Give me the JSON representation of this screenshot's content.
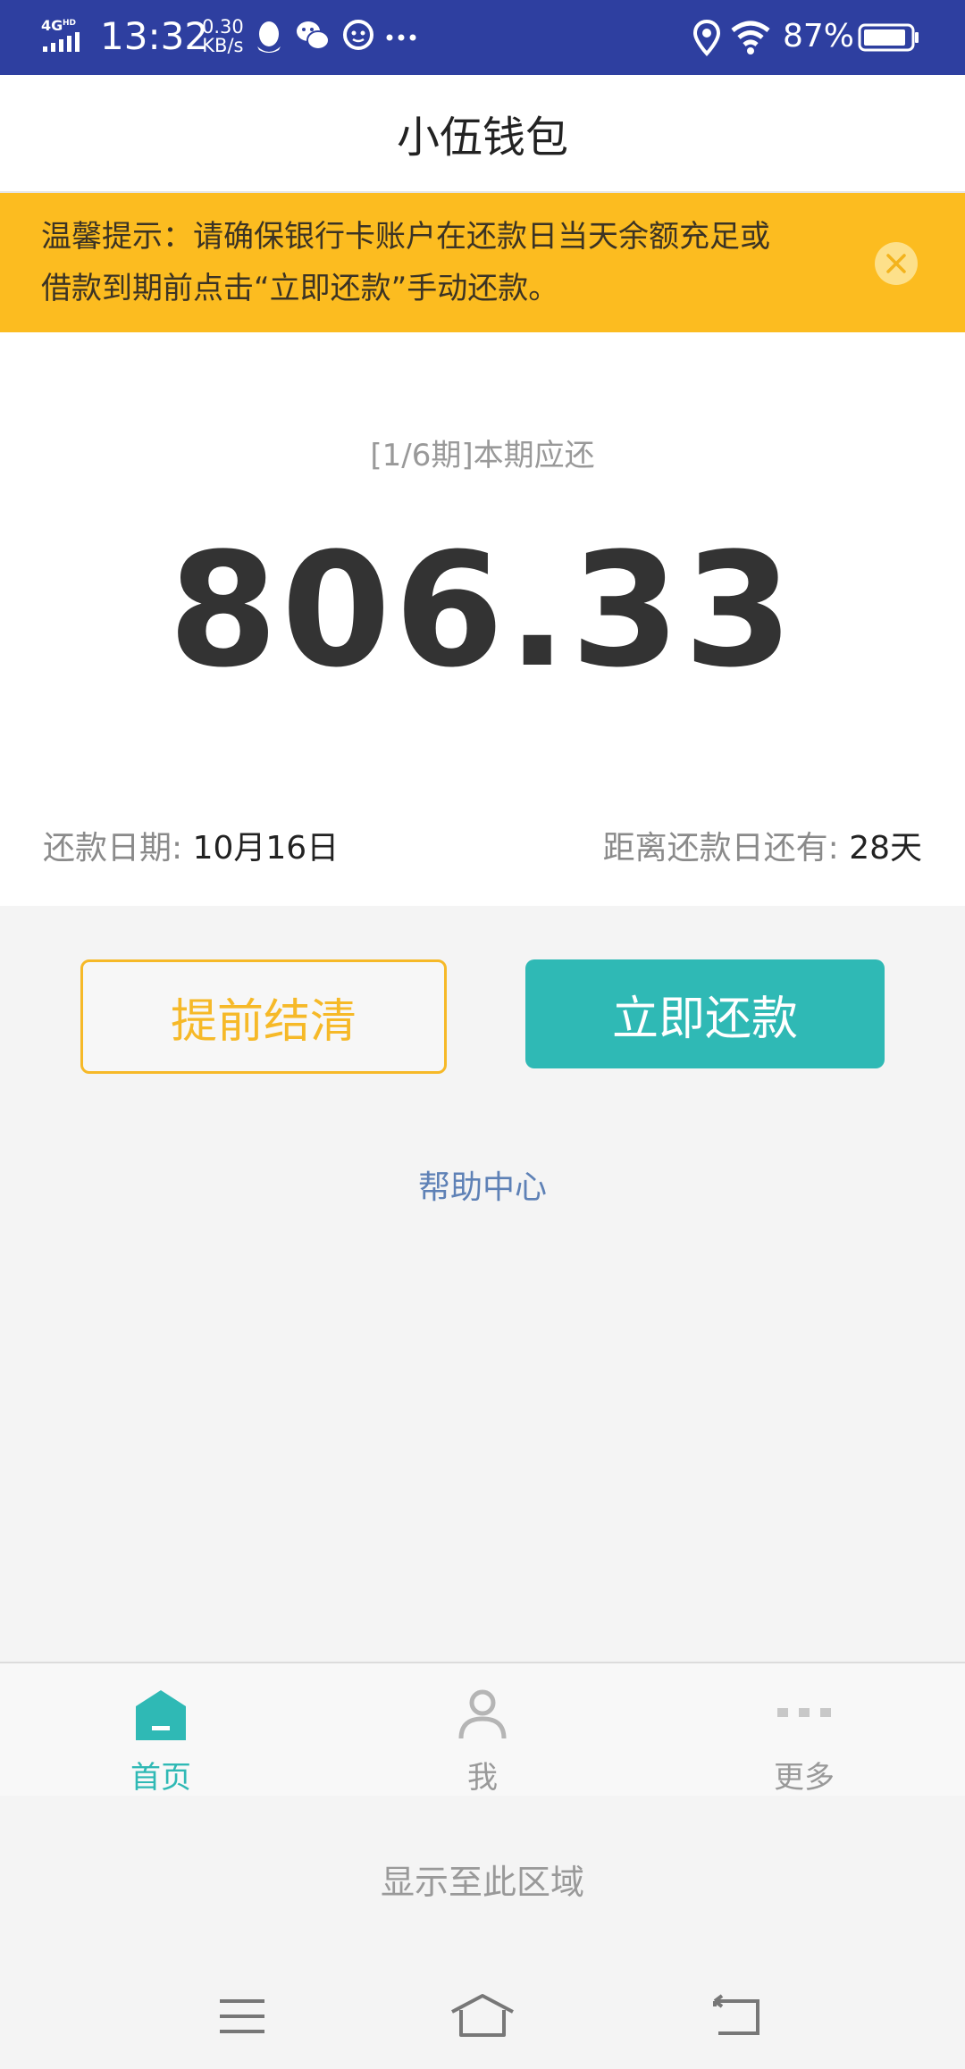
{
  "status_bar": {
    "network": "4G HD",
    "time": "13:32",
    "speed_value": "0.30",
    "speed_unit": "KB/s",
    "battery": "87%"
  },
  "header": {
    "title": "小伍钱包"
  },
  "notice": {
    "text_line1": "温馨提示：请确保银行卡账户在还款日当天余额充足或",
    "text_line2": "借款到期前点击“立即还款”手动还款。"
  },
  "bill": {
    "period_label": "[1/6期]本期应还",
    "amount": "806.33",
    "due_date_label": "还款日期: ",
    "due_date_value": "10月16日",
    "days_left_label": "距离还款日还有: ",
    "days_left_value": "28天"
  },
  "actions": {
    "early_settle_label": "提前结清",
    "repay_now_label": "立即还款"
  },
  "help": {
    "label": "帮助中心"
  },
  "tabs": [
    {
      "label": "首页",
      "icon": "home-icon",
      "active": true
    },
    {
      "label": "我",
      "icon": "user-icon",
      "active": false
    },
    {
      "label": "更多",
      "icon": "more-icon",
      "active": false
    }
  ],
  "footer": {
    "display_hint": "显示至此区域"
  },
  "colors": {
    "status_bar": "#2e3fa0",
    "notice_bg": "#fcbc20",
    "accent_teal": "#2fb9b5",
    "accent_yellow": "#f6b928",
    "link_blue": "#5e81b6"
  }
}
